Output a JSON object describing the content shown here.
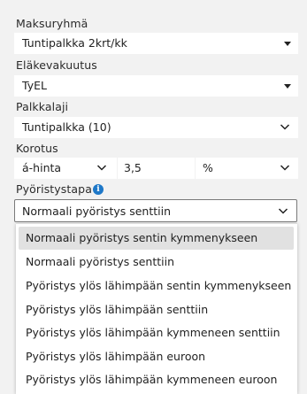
{
  "form": {
    "maksuryhma": {
      "label": "Maksuryhmä",
      "value": "Tuntipalkka 2krt/kk"
    },
    "elakevakuutus": {
      "label": "Eläkevakuutus",
      "value": "TyEL"
    },
    "palkkalaji": {
      "label": "Palkkalaji",
      "value": "Tuntipalkka (10)"
    },
    "korotus": {
      "label": "Korotus",
      "type_value": "á-hinta",
      "amount_value": "3,5",
      "unit_value": "%"
    },
    "pyoristystapa": {
      "label": "Pyöristystapa",
      "info_icon": "info-icon",
      "value": "Normaali pyöristys senttiin"
    }
  },
  "dropdown": {
    "options": [
      "Normaali pyöristys sentin kymmenykseen",
      "Normaali pyöristys senttiin",
      "Pyöristys ylös lähimpään sentin kymmenykseen",
      "Pyöristys ylös lähimpään senttiin",
      "Pyöristys ylös lähimpään kymmeneen senttiin",
      "Pyöristys ylös lähimpään euroon",
      "Pyöristys ylös lähimpään kymmeneen euroon"
    ],
    "highlighted_index": 0
  },
  "colors": {
    "background": "#f2f2f2",
    "field": "#ffffff",
    "info_icon": "#1e78c8",
    "highlight": "#e1e1e1"
  }
}
